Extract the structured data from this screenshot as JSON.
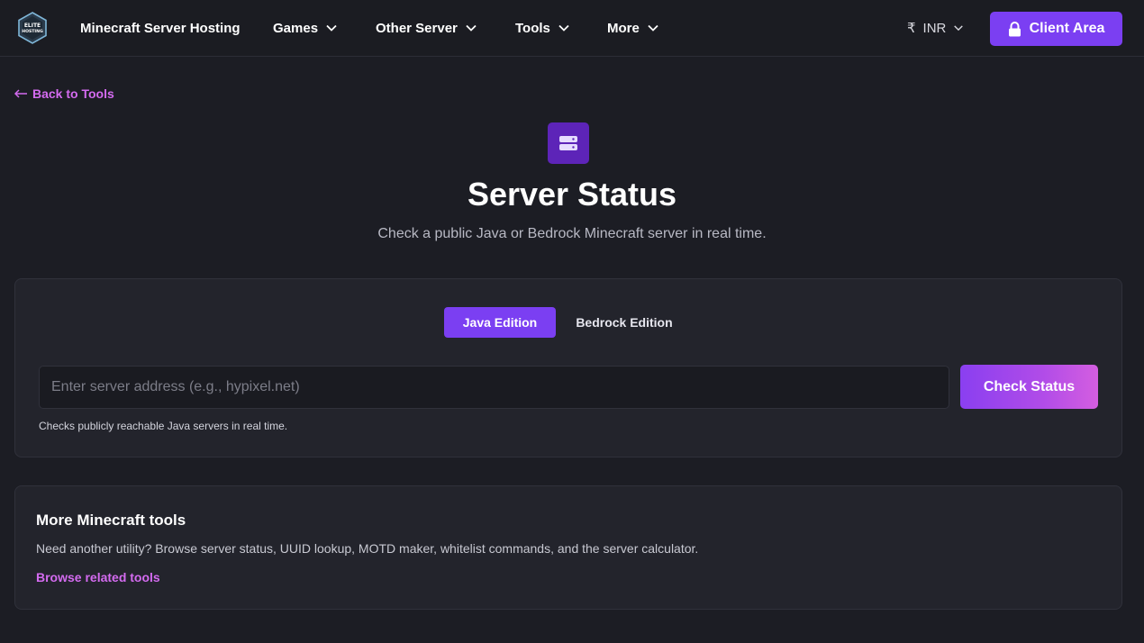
{
  "brand": {
    "logo_text_top": "ELITE",
    "logo_text_bottom": "HOSTING"
  },
  "nav": {
    "items": [
      {
        "label": "Minecraft Server Hosting"
      },
      {
        "label": "Games"
      },
      {
        "label": "Other Server"
      },
      {
        "label": "Tools"
      },
      {
        "label": "More"
      }
    ],
    "currency_symbol": "₹",
    "currency_code": "INR",
    "client_area_label": "Client Area"
  },
  "back_link": "Back to Tools",
  "hero": {
    "title": "Server Status",
    "subtitle": "Check a public Java or Bedrock Minecraft server in real time."
  },
  "checker": {
    "tabs": [
      {
        "label": "Java Edition",
        "active": true
      },
      {
        "label": "Bedrock Edition",
        "active": false
      }
    ],
    "input_value": "",
    "input_placeholder": "Enter server address (e.g., hypixel.net)",
    "check_button_label": "Check Status",
    "hint": "Checks publicly reachable Java servers in real time."
  },
  "more_tools": {
    "title": "More Minecraft tools",
    "description": "Need another utility? Browse server status, UUID lookup, MOTD maker, whitelist commands, and the server calculator.",
    "link_label": "Browse related tools"
  },
  "colors": {
    "accent": "#7b3ff2",
    "link": "#d46bf0",
    "background": "#1c1d24",
    "card": "#23242c"
  }
}
